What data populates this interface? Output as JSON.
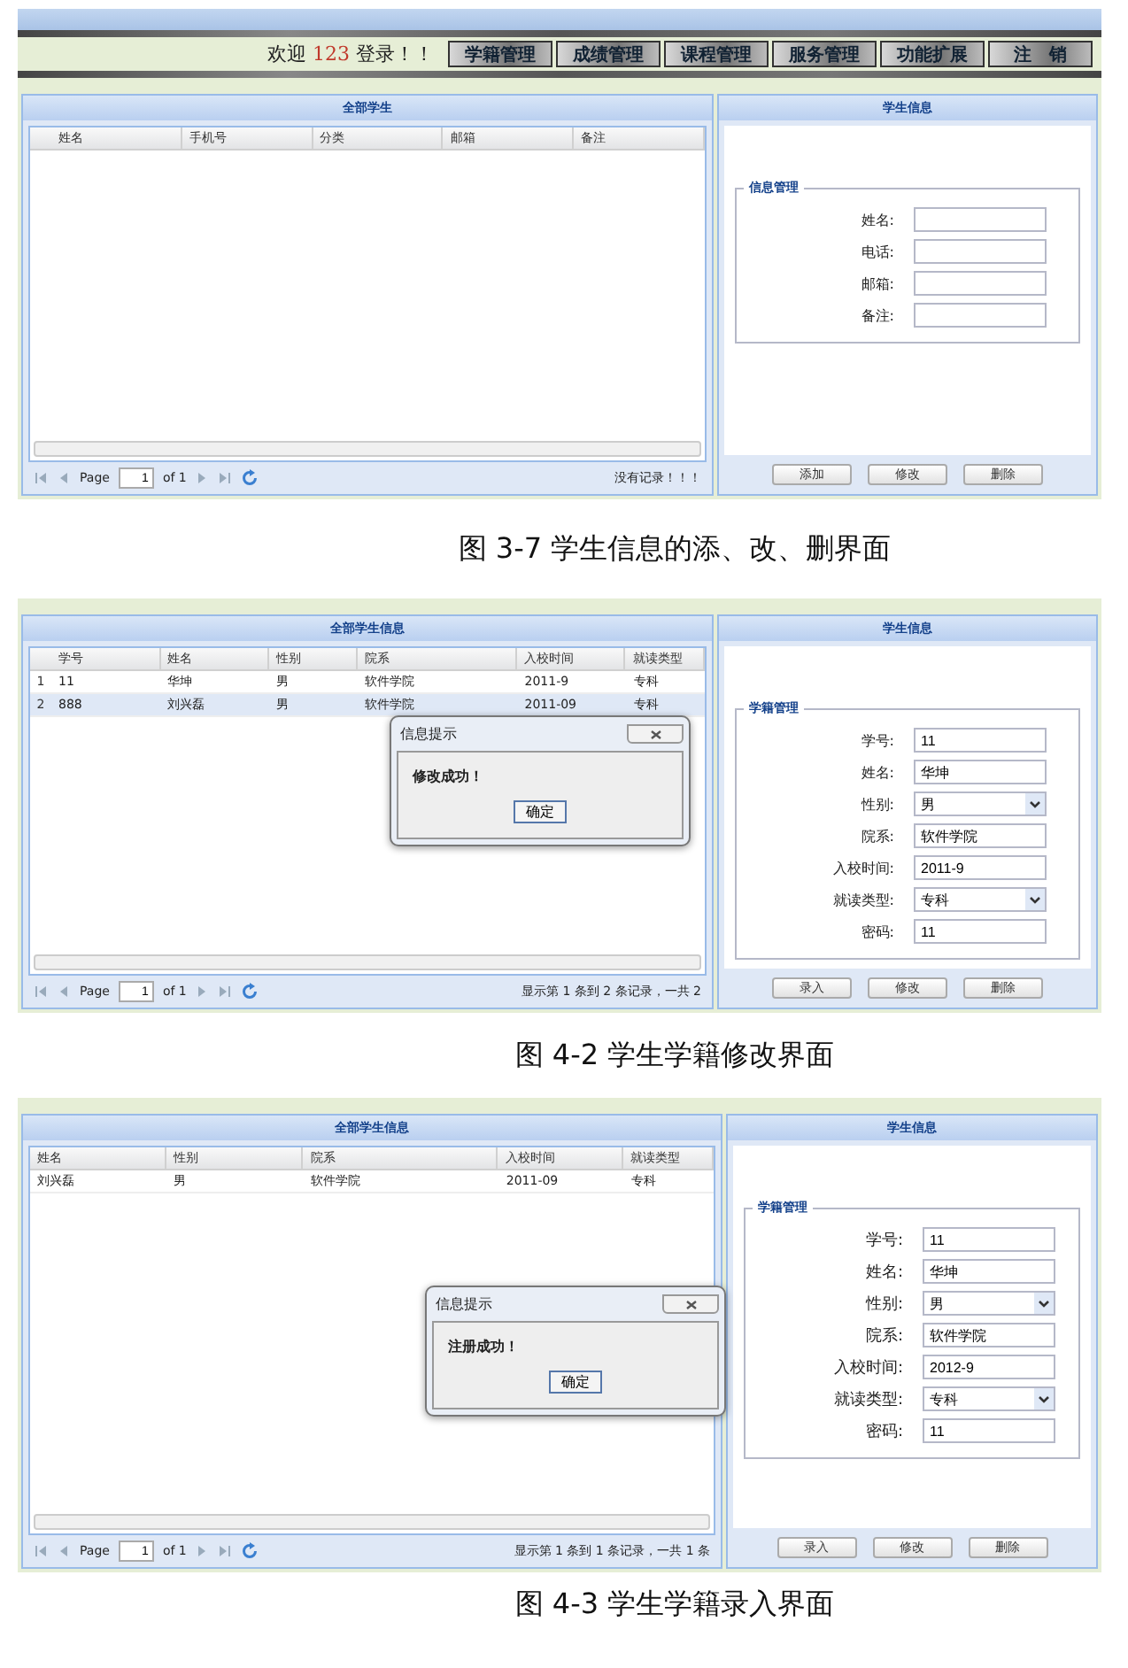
{
  "figures": [
    {
      "header": {
        "welcome_before": "欢迎",
        "user": "123",
        "welcome_after": "登录！！",
        "nav": [
          "学籍管理",
          "成绩管理",
          "课程管理",
          "服务管理",
          "功能扩展",
          "注　销"
        ]
      },
      "left_panel": {
        "title": "全部学生",
        "columns": [
          "姓名",
          "手机号",
          "分类",
          "邮箱",
          "备注"
        ],
        "pager": {
          "page_label": "Page",
          "page": "1",
          "of": "of 1",
          "info": "没有记录！！！"
        }
      },
      "right_panel": {
        "title": "学生信息",
        "legend": "信息管理",
        "fields": [
          {
            "label": "姓名:",
            "kind": "text"
          },
          {
            "label": "电话:",
            "kind": "text"
          },
          {
            "label": "邮箱:",
            "kind": "text"
          },
          {
            "label": "备注:",
            "kind": "text"
          }
        ],
        "buttons": [
          "添加",
          "修改",
          "删除"
        ]
      },
      "caption": "图 3-7  学生信息的添、改、删界面"
    },
    {
      "left_panel": {
        "title": "全部学生信息",
        "columns": [
          "学号",
          "姓名",
          "性别",
          "院系",
          "入校时间",
          "就读类型"
        ],
        "rows": [
          {
            "num": "1",
            "cells": [
              "11",
              "华坤",
              "男",
              "软件学院",
              "2011-9",
              "专科"
            ],
            "selected": false
          },
          {
            "num": "2",
            "cells": [
              "888",
              "刘兴磊",
              "男",
              "软件学院",
              "2011-09",
              "专科"
            ],
            "selected": true
          }
        ],
        "pager": {
          "page_label": "Page",
          "page": "1",
          "of": "of 1",
          "info": "显示第 1 条到 2 条记录，一共 2"
        }
      },
      "right_panel": {
        "title": "学生信息",
        "legend": "学籍管理",
        "fields": [
          {
            "label": "学号:",
            "kind": "text",
            "value": "11"
          },
          {
            "label": "姓名:",
            "kind": "text",
            "value": "华坤"
          },
          {
            "label": "性别:",
            "kind": "select",
            "value": "男"
          },
          {
            "label": "院系:",
            "kind": "text",
            "value": "软件学院"
          },
          {
            "label": "入校时间:",
            "kind": "text",
            "value": "2011-9"
          },
          {
            "label": "就读类型:",
            "kind": "select",
            "value": "专科"
          },
          {
            "label": "密码:",
            "kind": "text",
            "value": "11"
          }
        ],
        "buttons": [
          "录入",
          "修改",
          "删除"
        ]
      },
      "dialog": {
        "title": "信息提示",
        "message": "修改成功！",
        "ok": "确定"
      },
      "caption": "图 4-2  学生学籍修改界面"
    },
    {
      "left_panel": {
        "title": "全部学生信息",
        "columns": [
          "姓名",
          "性别",
          "院系",
          "入校时间",
          "就读类型"
        ],
        "rows": [
          {
            "cells": [
              "刘兴磊",
              "男",
              "软件学院",
              "2011-09",
              "专科"
            ],
            "selected": false
          }
        ],
        "pager": {
          "page_label": "Page",
          "page": "1",
          "of": "of 1",
          "info": "显示第 1 条到 1 条记录，一共 1 条"
        }
      },
      "right_panel": {
        "title": "学生信息",
        "legend": "学籍管理",
        "fields": [
          {
            "label": "学号:",
            "kind": "text",
            "value": "11"
          },
          {
            "label": "姓名:",
            "kind": "text",
            "value": "华坤"
          },
          {
            "label": "性别:",
            "kind": "select",
            "value": "男"
          },
          {
            "label": "院系:",
            "kind": "text",
            "value": "软件学院"
          },
          {
            "label": "入校时间:",
            "kind": "text",
            "value": "2012-9"
          },
          {
            "label": "就读类型:",
            "kind": "select",
            "value": "专科"
          },
          {
            "label": "密码:",
            "kind": "text",
            "value": "11"
          }
        ],
        "buttons": [
          "录入",
          "修改",
          "删除"
        ]
      },
      "dialog": {
        "title": "信息提示",
        "message": "注册成功！",
        "ok": "确定"
      },
      "caption": "图 4-3  学生学籍录入界面"
    }
  ]
}
